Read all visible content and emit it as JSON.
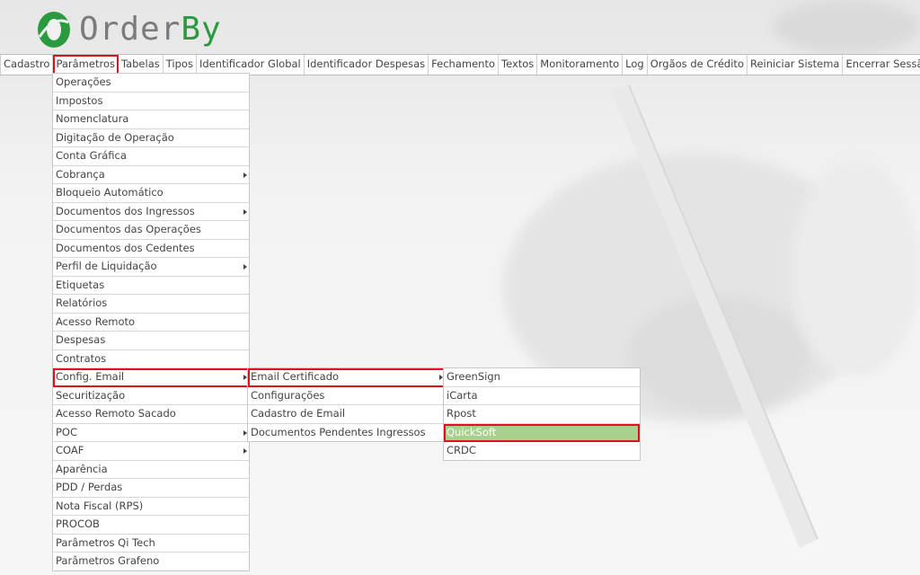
{
  "brand": {
    "name_main": "Order",
    "name_accent": "By"
  },
  "colors": {
    "brand_green": "#2b9a3e",
    "highlight_red": "#e0101e",
    "selected_bg": "#a9d18e"
  },
  "menubar": [
    "Cadastro",
    "Parâmetros",
    "Tabelas",
    "Tipos",
    "Identificador Global",
    "Identificador Despesas",
    "Fechamento",
    "Textos",
    "Monitoramento",
    "Log",
    "Orgãos de Crédito",
    "Reiniciar Sistema",
    "Encerrar Sessão"
  ],
  "parametros_menu": [
    "Operações",
    "Impostos",
    "Nomenclatura",
    "Digitação de Operação",
    "Conta Gráfica",
    "Cobrança",
    "Bloqueio Automático",
    "Documentos dos Ingressos",
    "Documentos das Operações",
    "Documentos dos Cedentes",
    "Perfil de Liquidação",
    "Etiquetas",
    "Relatórios",
    "Acesso Remoto",
    "Despesas",
    "Contratos",
    "Config. Email",
    "Securitização",
    "Acesso Remoto Sacado",
    "POC",
    "COAF",
    "Aparência",
    "PDD / Perdas",
    "Nota Fiscal (RPS)",
    "PROCOB",
    "Parâmetros Qi Tech",
    "Parâmetros Grafeno"
  ],
  "config_email_menu": [
    "Email Certificado",
    "Configurações",
    "Cadastro de Email",
    "Documentos Pendentes Ingressos"
  ],
  "email_certificado_menu": [
    "GreenSign",
    "iCarta",
    "Rpost",
    "QuickSoft",
    "CRDC"
  ]
}
